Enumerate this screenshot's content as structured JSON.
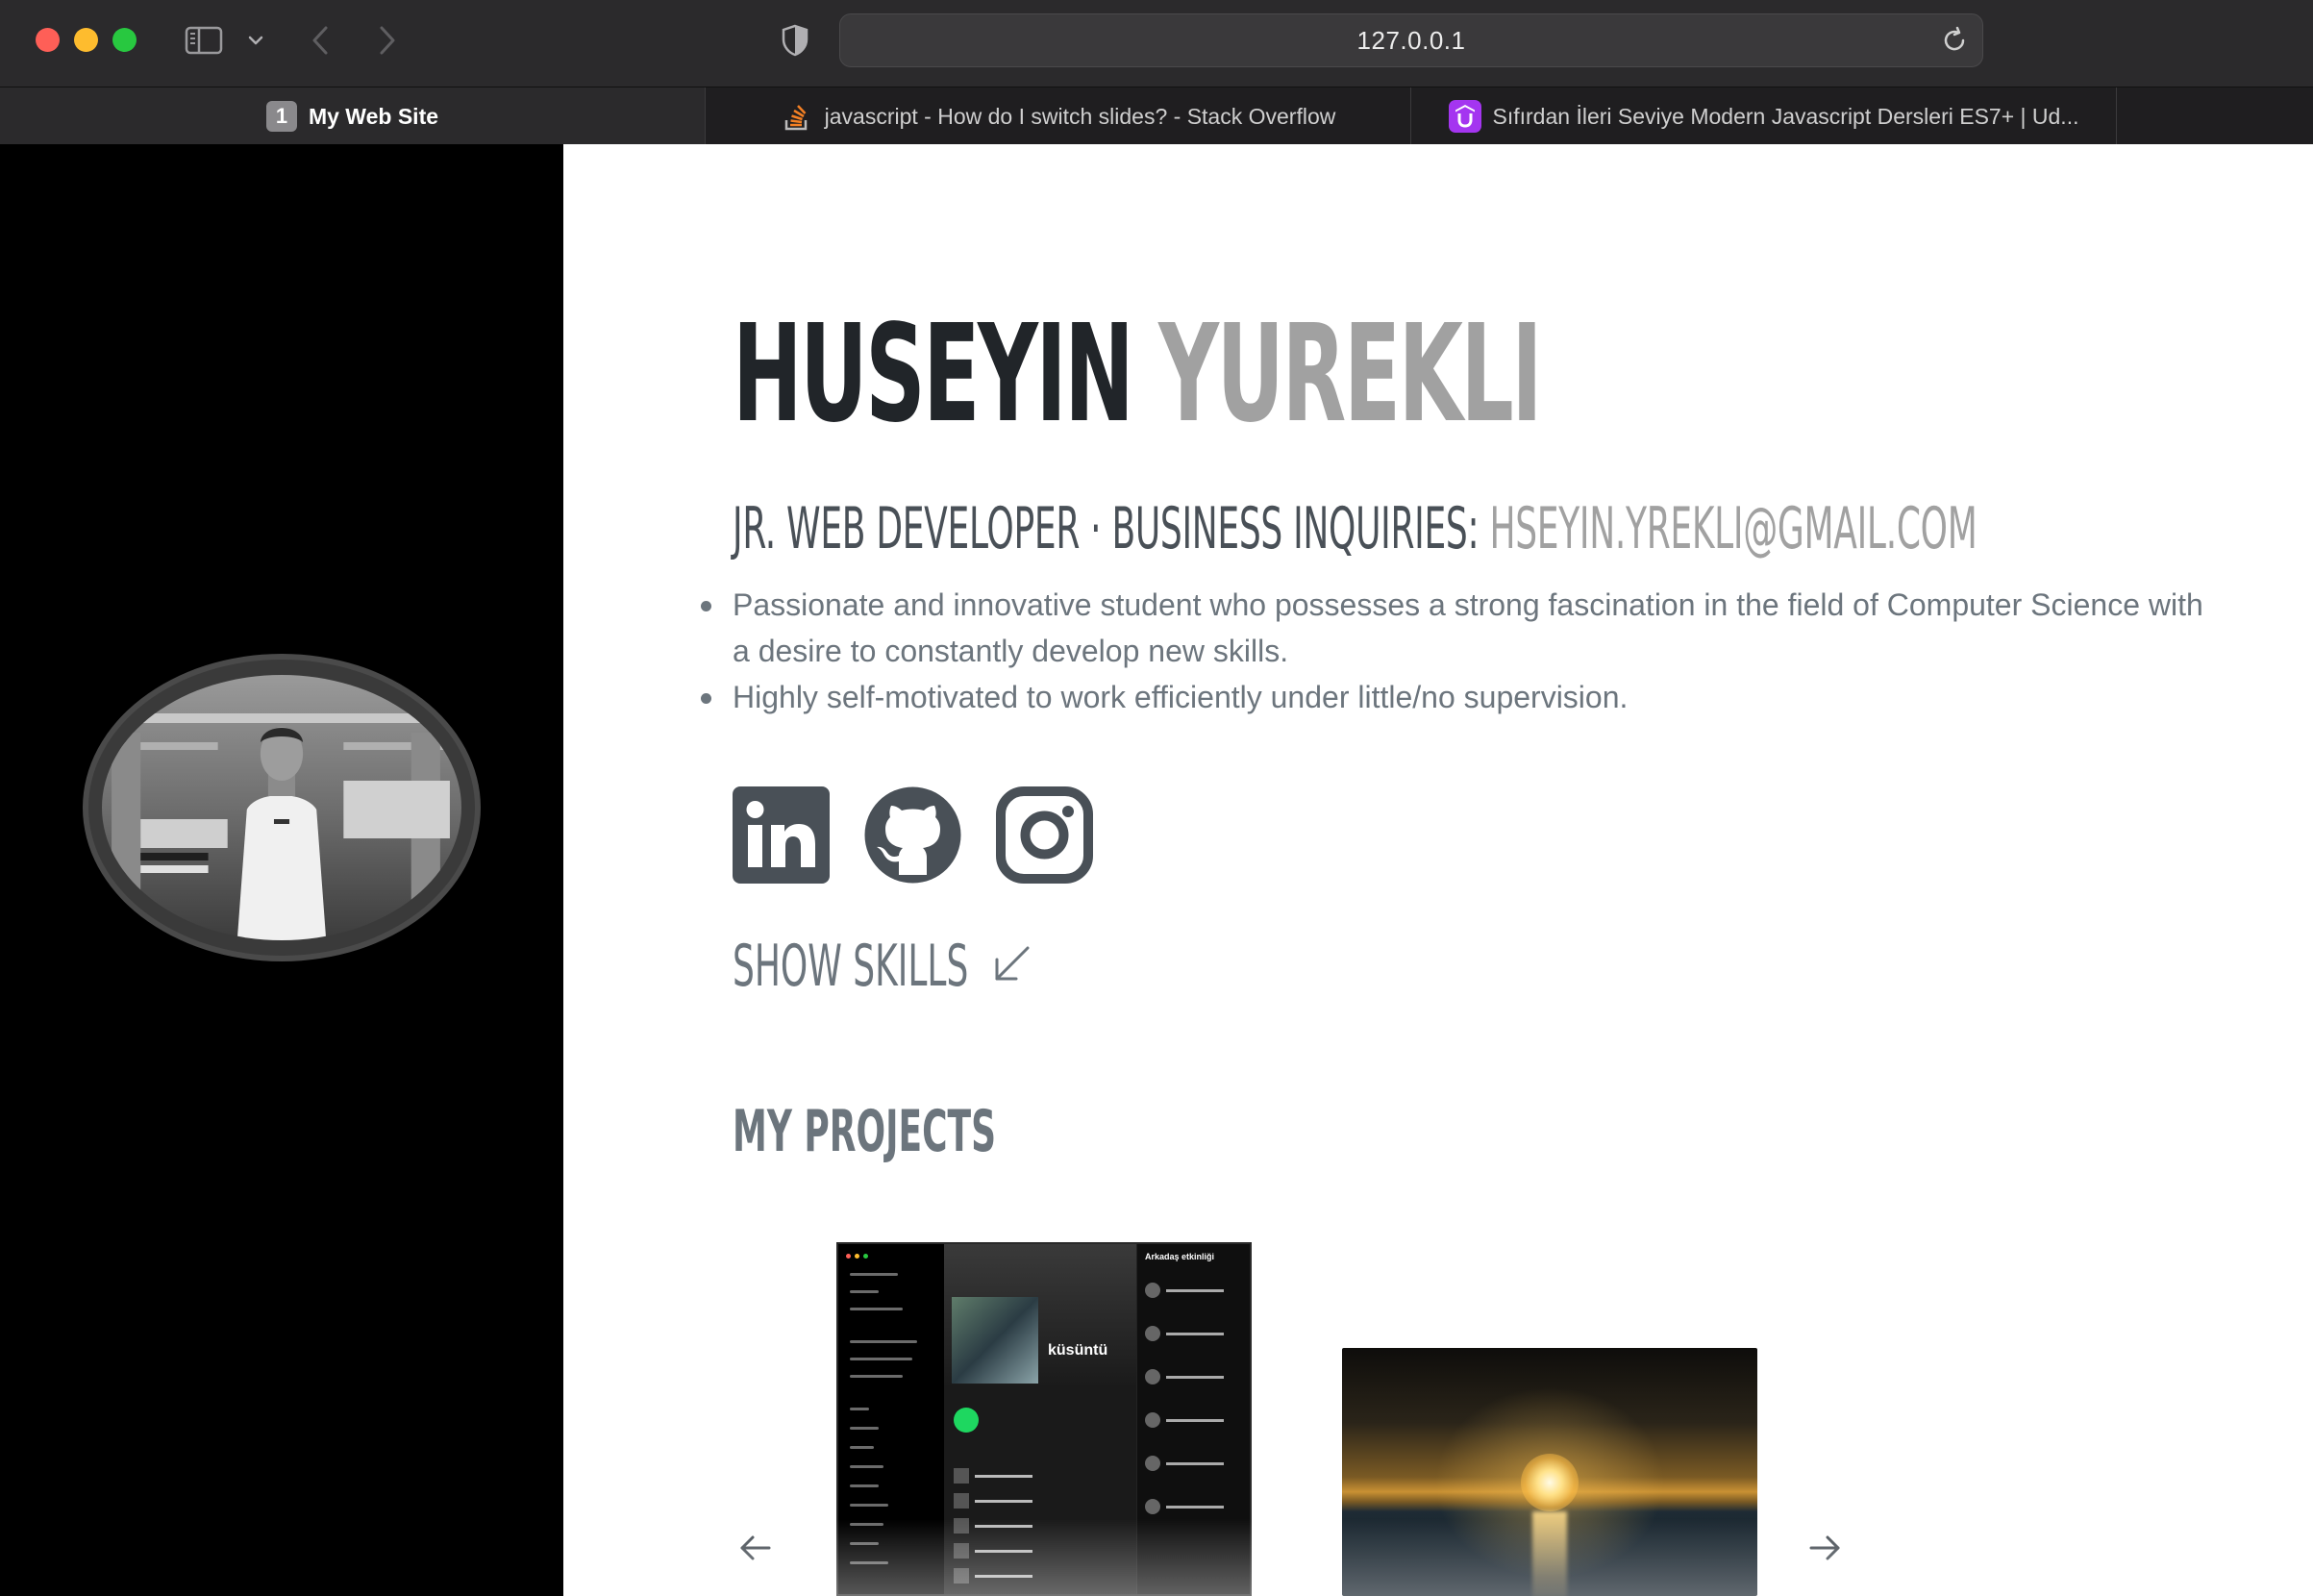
{
  "browser": {
    "address": "127.0.0.1",
    "tabs": [
      {
        "index": "1",
        "title": "My Web Site",
        "active": true
      },
      {
        "title": "javascript - How do I switch slides? - Stack Overflow",
        "favicon": "stackoverflow-icon"
      },
      {
        "title": "Sıfırdan İleri Seviye Modern Javascript Dersleri ES7+ | Ud...",
        "favicon": "udemy-icon"
      }
    ]
  },
  "profile": {
    "first_name": "HUSEYIN",
    "last_name": "YUREKLI",
    "subtitle_prefix": "JR. WEB DEVELOPER · BUSINESS INQUIRIES: ",
    "email": "HSEYIN.YREKLI@GMAIL.COM",
    "bio": [
      "Passionate and innovative student who possesses a strong fascination in the field of Computer Science with a desire to constantly develop new skills.",
      "Highly self-motivated to work efficiently under little/no supervision."
    ],
    "social": [
      "linkedin-icon",
      "github-icon",
      "instagram-icon"
    ],
    "show_skills": "SHOW SKILLS"
  },
  "projects": {
    "title": "MY PROJECTS",
    "spotify_playlist_title": "küsüntü",
    "spotify_friends_title": "Arkadaş etkinliği"
  },
  "colors": {
    "dark_text": "#212529",
    "muted_text": "#6c757d",
    "light_gray": "#a1a1a1",
    "sidebar_bg": "#000000",
    "spotify_green": "#1ed760"
  }
}
